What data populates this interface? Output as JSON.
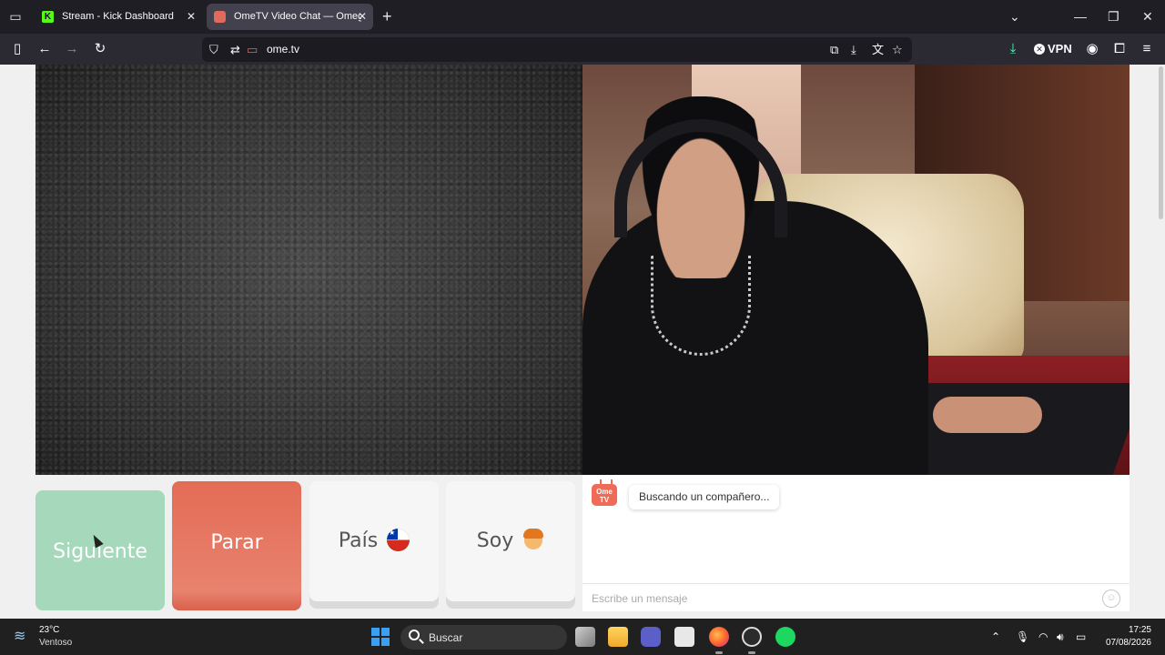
{
  "browser": {
    "tabs": [
      {
        "title": "Stream - Kick Dashboard",
        "favicon": "kick-icon",
        "active": false
      },
      {
        "title": "OmeTV Video Chat — Omegle Alternative",
        "favicon": "ometv-icon",
        "active": true
      }
    ],
    "url": "ome.tv",
    "vpn_label": "VPN",
    "colors": {
      "tabbar": "#1f1e25",
      "toolbar": "#2b2a33",
      "urlbar": "#1c1b22"
    }
  },
  "controls": {
    "next_label": "Siguiente",
    "stop_label": "Parar",
    "country_label": "País",
    "country_flag": "chile-flag-icon",
    "gender_label": "Soy",
    "gender_icon": "person-icon",
    "colors": {
      "next": "#a6d9bb",
      "stop": "#e36c56",
      "neutral": "#f6f6f6"
    }
  },
  "chat": {
    "logo_text": "Ome TV",
    "status_message": "Buscando un compañero...",
    "message_placeholder": "Escribe un mensaje"
  },
  "taskbar": {
    "weather_temp": "23°C",
    "weather_desc": "Ventoso",
    "search_label": "Buscar",
    "time": "17:25",
    "date": "07/08/2026",
    "apps": [
      "task-view-icon",
      "file-explorer-icon",
      "teams-icon",
      "store-icon",
      "firefox-icon",
      "obs-icon",
      "spotify-icon"
    ]
  }
}
